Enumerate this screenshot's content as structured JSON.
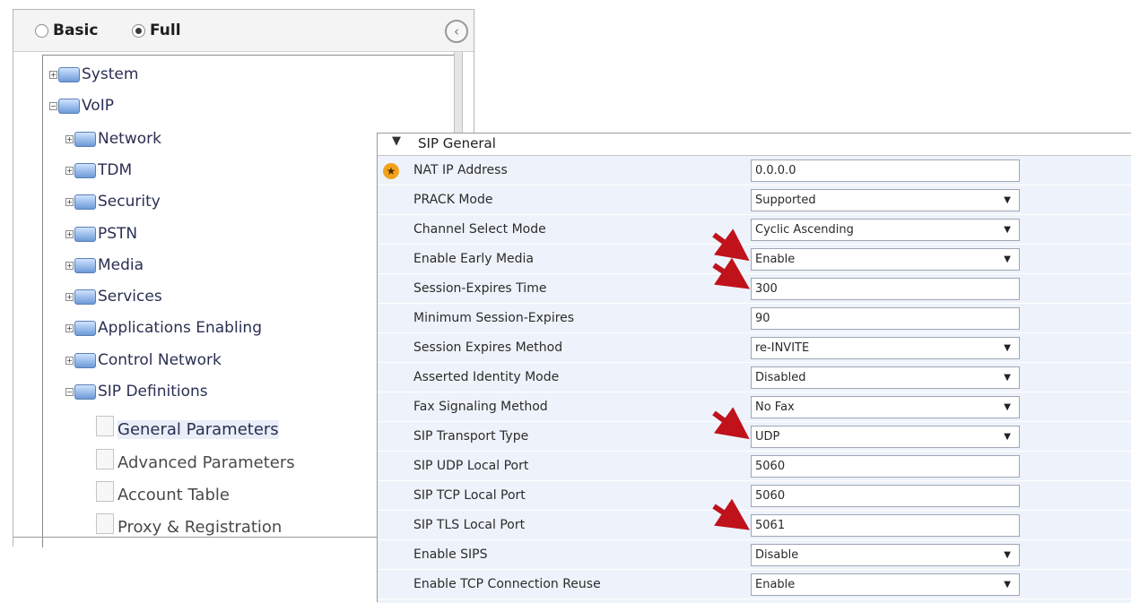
{
  "mode": {
    "basic_label": "Basic",
    "full_label": "Full",
    "selected": "Full"
  },
  "nav": {
    "top_items": [
      {
        "label": "System"
      },
      {
        "label": "VoIP"
      }
    ],
    "voip_items": [
      {
        "label": "Network"
      },
      {
        "label": "TDM"
      },
      {
        "label": "Security"
      },
      {
        "label": "PSTN"
      },
      {
        "label": "Media"
      },
      {
        "label": "Services"
      },
      {
        "label": "Applications Enabling"
      },
      {
        "label": "Control Network"
      },
      {
        "label": "SIP Definitions"
      }
    ],
    "sip_items": [
      {
        "label": "General Parameters"
      },
      {
        "label": "Advanced Parameters"
      },
      {
        "label": "Account Table"
      },
      {
        "label": "Proxy & Registration"
      }
    ]
  },
  "sip_general": {
    "title": "SIP General",
    "rows": [
      {
        "label": "NAT IP Address",
        "value": "0.0.0.0",
        "kind": "input"
      },
      {
        "label": "PRACK Mode",
        "value": "Supported",
        "kind": "select"
      },
      {
        "label": "Channel Select Mode",
        "value": "Cyclic Ascending",
        "kind": "select"
      },
      {
        "label": "Enable Early Media",
        "value": "Enable",
        "kind": "select"
      },
      {
        "label": "Session-Expires Time",
        "value": "300",
        "kind": "input"
      },
      {
        "label": "Minimum Session-Expires",
        "value": "90",
        "kind": "input"
      },
      {
        "label": "Session Expires Method",
        "value": "re-INVITE",
        "kind": "select"
      },
      {
        "label": "Asserted Identity Mode",
        "value": "Disabled",
        "kind": "select"
      },
      {
        "label": "Fax Signaling Method",
        "value": "No Fax",
        "kind": "select"
      },
      {
        "label": "SIP Transport Type",
        "value": "UDP",
        "kind": "select"
      },
      {
        "label": "SIP UDP Local Port",
        "value": "5060",
        "kind": "input"
      },
      {
        "label": "SIP TCP Local Port",
        "value": "5060",
        "kind": "input"
      },
      {
        "label": "SIP TLS Local Port",
        "value": "5061",
        "kind": "input"
      },
      {
        "label": "Enable SIPS",
        "value": "Disable",
        "kind": "select"
      },
      {
        "label": "Enable TCP Connection Reuse",
        "value": "Enable",
        "kind": "select"
      }
    ]
  },
  "icons": {
    "select_arrow": "▼",
    "section_toggle": "▼",
    "collapse": "‹",
    "plus": "+",
    "minus": "−",
    "star": "★"
  },
  "colors": {
    "arrow_red": "#c0121b",
    "row_bg": "#eef3fb",
    "star_orange": "#f2a31b"
  }
}
